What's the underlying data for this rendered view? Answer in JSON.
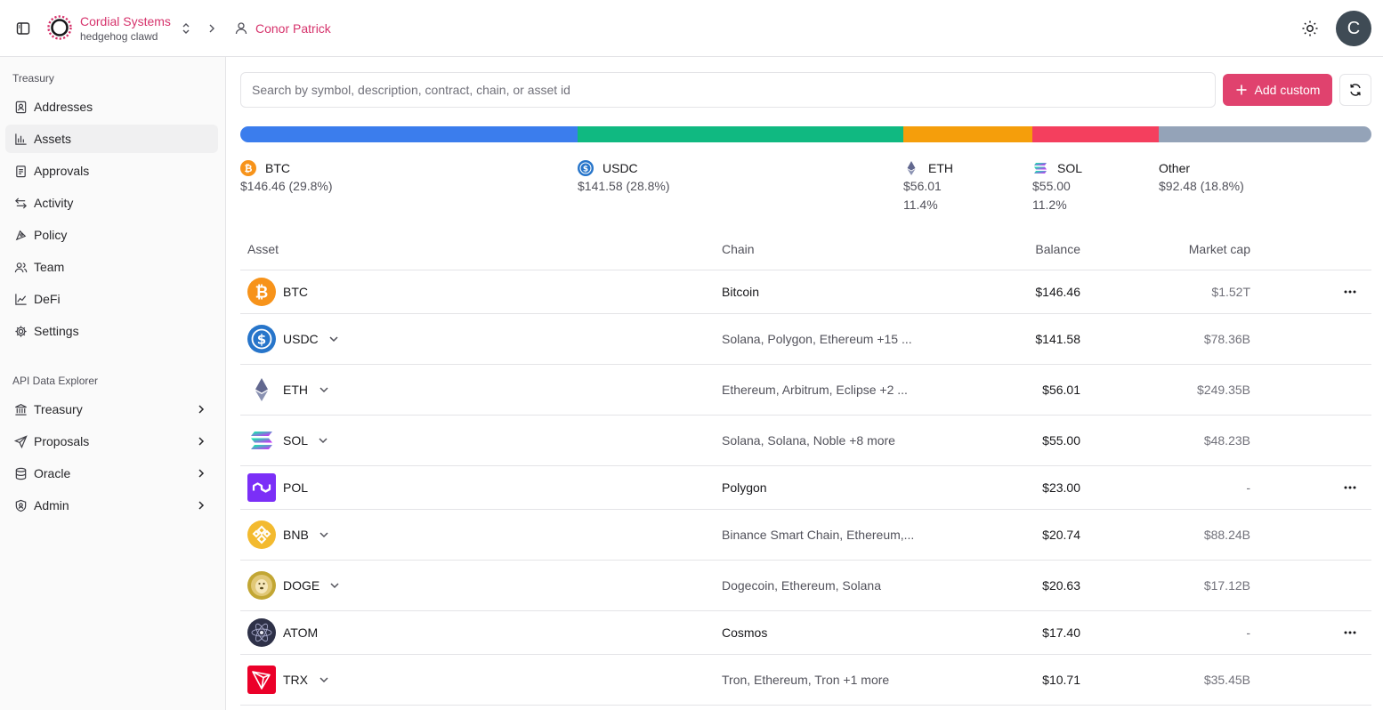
{
  "header": {
    "org_name": "Cordial Systems",
    "org_sub": "hedgehog clawd",
    "user_name": "Conor Patrick",
    "avatar_letter": "C"
  },
  "sidebar": {
    "section_treasury": "Treasury",
    "treasury_items": [
      {
        "label": "Addresses",
        "icon": "address-book-icon"
      },
      {
        "label": "Assets",
        "icon": "chart-icon",
        "active": true
      },
      {
        "label": "Approvals",
        "icon": "clipboard-icon"
      },
      {
        "label": "Activity",
        "icon": "arrows-icon"
      },
      {
        "label": "Policy",
        "icon": "compass-icon"
      },
      {
        "label": "Team",
        "icon": "users-icon"
      },
      {
        "label": "DeFi",
        "icon": "line-chart-icon"
      },
      {
        "label": "Settings",
        "icon": "gear-icon"
      }
    ],
    "section_api": "API Data Explorer",
    "api_items": [
      {
        "label": "Treasury",
        "icon": "bank-icon"
      },
      {
        "label": "Proposals",
        "icon": "send-icon"
      },
      {
        "label": "Oracle",
        "icon": "database-icon"
      },
      {
        "label": "Admin",
        "icon": "shield-icon"
      }
    ]
  },
  "search": {
    "placeholder": "Search by symbol, description, contract, chain, or asset id"
  },
  "toolbar": {
    "add_label": "Add custom"
  },
  "allocation": {
    "segments": [
      {
        "symbol": "BTC",
        "value": "$146.46 (29.8%)",
        "fraction": 0.298,
        "color": "#3b7ded"
      },
      {
        "symbol": "USDC",
        "value": "$141.58 (28.8%)",
        "fraction": 0.288,
        "color": "#10b981"
      },
      {
        "symbol": "ETH",
        "value": "$56.01",
        "value2": "11.4%",
        "fraction": 0.114,
        "color": "#f59e0b"
      },
      {
        "symbol": "SOL",
        "value": "$55.00",
        "value2": "11.2%",
        "fraction": 0.112,
        "color": "#f43f5e"
      },
      {
        "symbol": "Other",
        "value": "$92.48 (18.8%)",
        "fraction": 0.188,
        "color": "#94a3b8"
      }
    ]
  },
  "table": {
    "headers": {
      "asset": "Asset",
      "chain": "Chain",
      "balance": "Balance",
      "market_cap": "Market cap"
    },
    "rows": [
      {
        "symbol": "BTC",
        "chain": "Bitcoin",
        "balance": "$146.46",
        "market_cap": "$1.52T",
        "expandable": false
      },
      {
        "symbol": "USDC",
        "chain": "Solana, Polygon, Ethereum +15 ...",
        "balance": "$141.58",
        "market_cap": "$78.36B",
        "expandable": true
      },
      {
        "symbol": "ETH",
        "chain": "Ethereum, Arbitrum, Eclipse +2 ...",
        "balance": "$56.01",
        "market_cap": "$249.35B",
        "expandable": true
      },
      {
        "symbol": "SOL",
        "chain": "Solana, Solana, Noble +8 more",
        "balance": "$55.00",
        "market_cap": "$48.23B",
        "expandable": true
      },
      {
        "symbol": "POL",
        "chain": "Polygon",
        "balance": "$23.00",
        "market_cap": "-",
        "expandable": false
      },
      {
        "symbol": "BNB",
        "chain": "Binance Smart Chain, Ethereum,...",
        "balance": "$20.74",
        "market_cap": "$88.24B",
        "expandable": true
      },
      {
        "symbol": "DOGE",
        "chain": "Dogecoin, Ethereum, Solana",
        "balance": "$20.63",
        "market_cap": "$17.12B",
        "expandable": true
      },
      {
        "symbol": "ATOM",
        "chain": "Cosmos",
        "balance": "$17.40",
        "market_cap": "-",
        "expandable": false
      },
      {
        "symbol": "TRX",
        "chain": "Tron, Ethereum, Tron +1 more",
        "balance": "$10.71",
        "market_cap": "$35.45B",
        "expandable": true
      }
    ]
  },
  "colors": {
    "brand": "#d6336c",
    "button": "#e0426e"
  }
}
